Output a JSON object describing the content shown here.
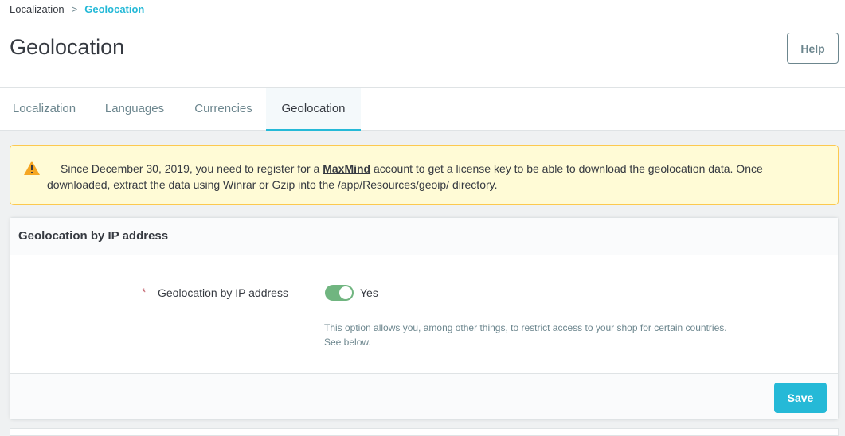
{
  "breadcrumb": {
    "parent": "Localization",
    "separator": ">",
    "current": "Geolocation"
  },
  "page": {
    "title": "Geolocation",
    "help_label": "Help"
  },
  "tabs": [
    {
      "label": "Localization",
      "active": false
    },
    {
      "label": "Languages",
      "active": false
    },
    {
      "label": "Currencies",
      "active": false
    },
    {
      "label": "Geolocation",
      "active": true
    }
  ],
  "alert": {
    "icon": "warning-icon",
    "text_before": "Since December 30, 2019, you need to register for a",
    "link": "MaxMind",
    "text_after": "account to get a license key to be able to download the geolocation data. Once downloaded, extract the data using Winrar or Gzip into the /app/Resources/geoip/ directory."
  },
  "card": {
    "title": "Geolocation by IP address",
    "field": {
      "required_marker": "*",
      "label": "Geolocation by IP address",
      "switch_state": true,
      "switch_label": "Yes",
      "help_line1": "This option allows you, among other things, to restrict access to your shop for certain countries.",
      "help_line2": "See below."
    },
    "save_label": "Save"
  },
  "colors": {
    "accent": "#25b9d7",
    "switch_on": "#70b580",
    "warning_bg": "#fffbd6",
    "warning_border": "#fcc94f",
    "warning_icon": "#f5a623"
  }
}
